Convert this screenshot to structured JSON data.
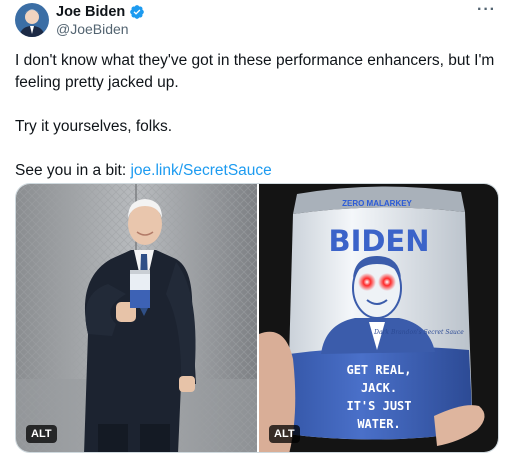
{
  "author": {
    "display_name": "Joe Biden",
    "handle": "@JoeBiden",
    "avatar_icon": "avatar-icon",
    "verified_icon": "verified-badge-icon",
    "verified_color": "#1d9bf0"
  },
  "more_icon": "more-options-icon",
  "tweet": {
    "line1": "I don't know what they've got in these performance enhancers, but I'm feeling pretty jacked up.",
    "line2": "Try it yourselves, folks.",
    "line3_prefix": "See you in a bit: ",
    "link_text": "joe.link/SecretSauce",
    "link_color": "#1d9bf0"
  },
  "media": [
    {
      "alt_label": "ALT"
    },
    {
      "alt_label": "ALT",
      "can": {
        "top_text": "ZERO MALARKEY",
        "brand": "BIDEN",
        "signature": "Dark Brandon's Secret Sauce",
        "line1": "GET REAL,",
        "line2": "JACK.",
        "line3": "IT'S JUST",
        "line4": "WATER."
      }
    }
  ]
}
